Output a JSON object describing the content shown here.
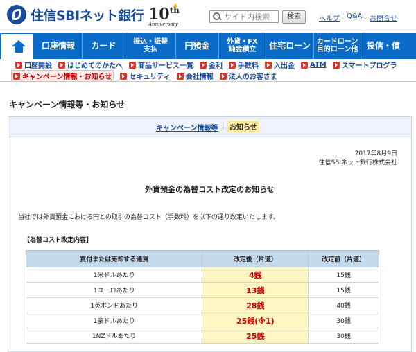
{
  "header": {
    "logo_text": "住信SBIネット銀行",
    "anniversary_number": "10",
    "anniversary_suffix": "th",
    "anniversary_label": "Anniversary",
    "search_placeholder": "サイト内検索",
    "search_button": "検索",
    "util_links": [
      "ヘルプ",
      "Q&A",
      "お問合せ"
    ]
  },
  "main_nav": [
    {
      "label": "口座情報"
    },
    {
      "label": "カード"
    },
    {
      "label": "振込・振替\n支払"
    },
    {
      "label": "円預金"
    },
    {
      "label": "外貨・FX\n純金積立"
    },
    {
      "label": "住宅ローン"
    },
    {
      "label": "カードローン\n目的ローン他"
    },
    {
      "label": "投信・債"
    }
  ],
  "sub_nav": {
    "row1": [
      "口座開設",
      "はじめてのかたへ",
      "商品サービス一覧",
      "金利",
      "手数料",
      "入出金",
      "ATM",
      "スマートプログラ"
    ],
    "row2": [
      "キャンペーン情報・お知らせ",
      "セキュリティ",
      "会社情報",
      "法人のお客さま"
    ],
    "active": "キャンペーン情報・お知らせ"
  },
  "page_title": "キャンペーン情報等・お知らせ",
  "tabs": {
    "link": "キャンペーン情報等",
    "separator": "|",
    "active": "お知らせ"
  },
  "notice": {
    "date": "2017年8月9日",
    "company": "住信SBIネット銀行株式会社",
    "title": "外貨預金の為替コスト改定のお知らせ",
    "intro": "当社では外貨預金における円との取引の為替コスト（手数料）を以下の通り改定いたします。",
    "section_head": "【為替コスト改定内容】",
    "table": {
      "headers": [
        "買付または売却する通貨",
        "改定後（片道）",
        "改定前（片道）"
      ],
      "rows": [
        [
          "1米ドルあたり",
          "4銭",
          "15銭"
        ],
        [
          "1ユーロあたり",
          "13銭",
          "15銭"
        ],
        [
          "1英ポンドあたり",
          "28銭",
          "40銭"
        ],
        [
          "1豪ドルあたり",
          "25銭(※1)",
          "30銭"
        ],
        [
          "1NZドルあたり",
          "25銭",
          "30銭"
        ]
      ]
    }
  },
  "colors": {
    "brand_blue": "#1a4b9a",
    "nav_blue": "#0a6bc9",
    "accent_red": "#cc0000",
    "highlight_yellow": "#fdf6c3"
  }
}
